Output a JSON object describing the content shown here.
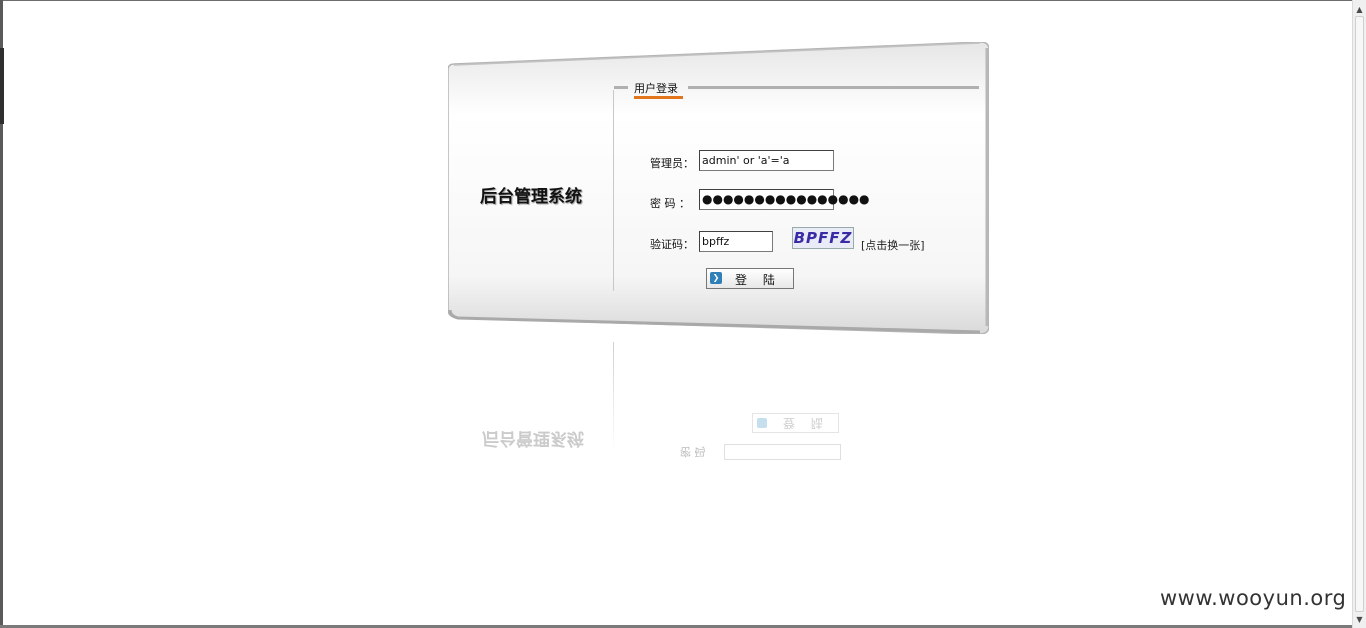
{
  "app": {
    "system_title": "后台管理系统",
    "section_title": "用户登录"
  },
  "form": {
    "admin_label": "管理员：",
    "admin_value": "admin' or 'a'='a",
    "password_label": "密  码 ：",
    "password_value": "●●●●●●●●●●●●●●●●",
    "captcha_label": "验证码：",
    "captcha_value": "bpffz",
    "captcha_image_text": "BPFFZ",
    "captcha_refresh": "[点击换一张]",
    "login_button": "登 陆"
  },
  "reflection": {
    "title": "后台管理系统",
    "button": "登 陆",
    "password_label": "密 码"
  },
  "watermark": "www.wooyun.org",
  "colors": {
    "accent_underline": "#e2761c",
    "captcha_text": "#3a2aa6",
    "button_icon": "#2f7fb8"
  },
  "icons": {
    "button_icon": "arrow-right-icon",
    "scroll_up": "triangle-up-icon",
    "scroll_down": "triangle-down-icon"
  }
}
